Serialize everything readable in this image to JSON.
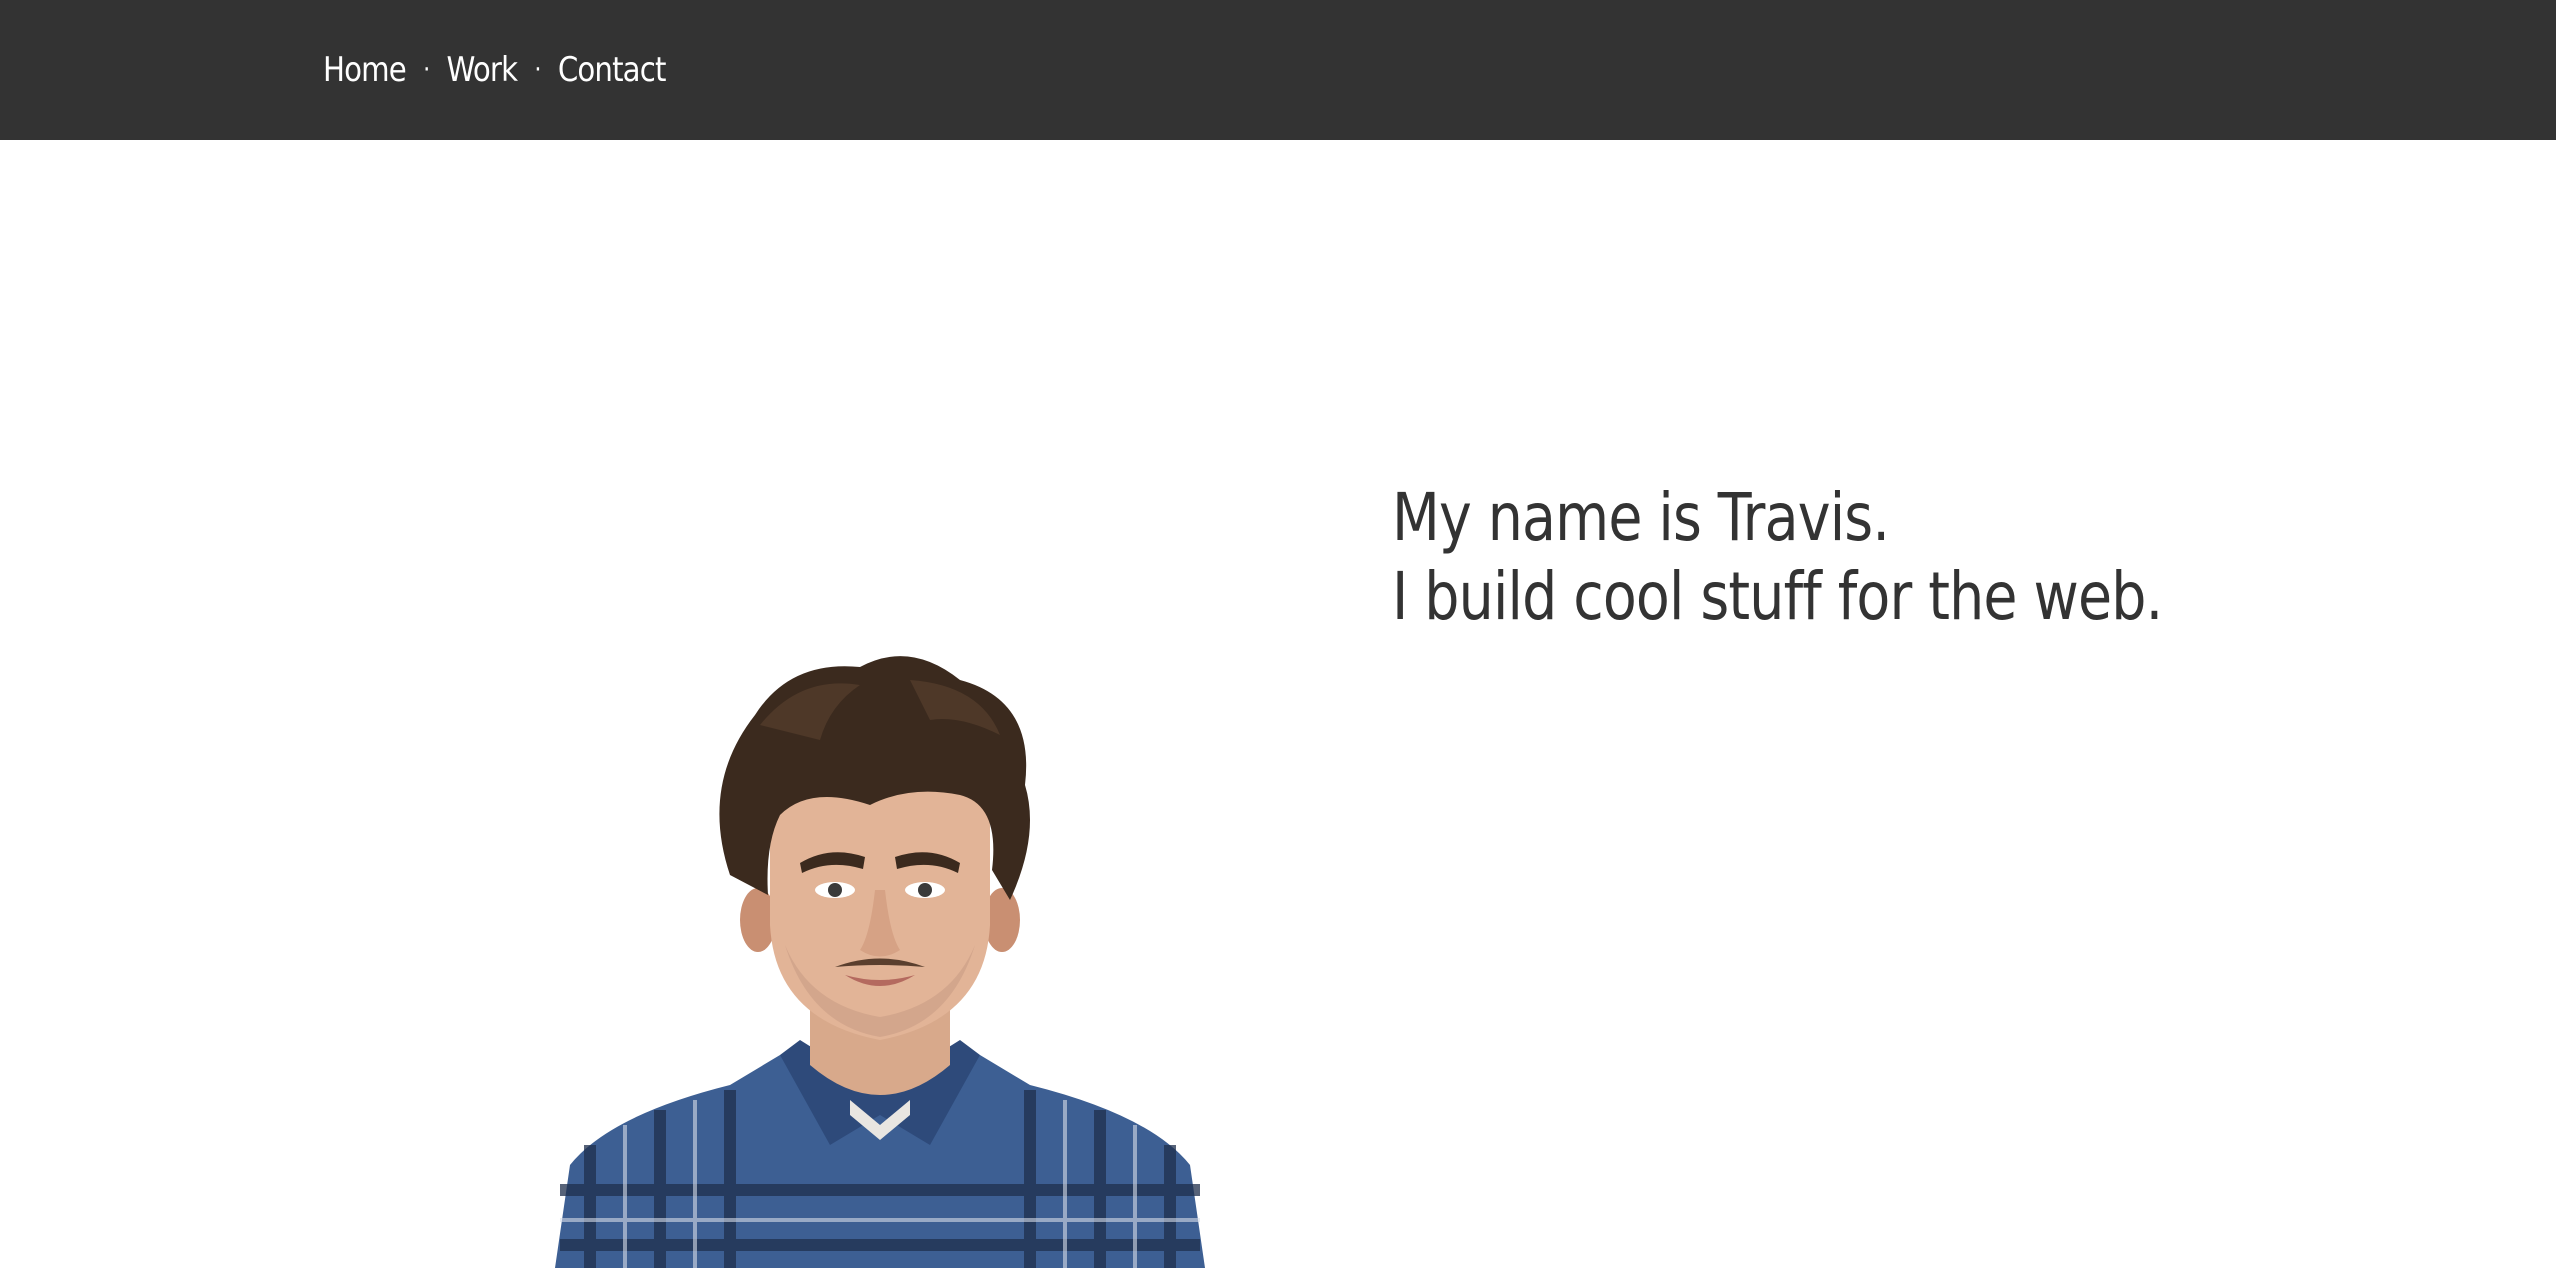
{
  "nav": {
    "items": [
      "Home",
      "Work",
      "Contact"
    ],
    "separator": "·"
  },
  "hero": {
    "line1": "My name is Travis.",
    "line2": "I build cool stuff for the web."
  },
  "colors": {
    "topbar": "#333333",
    "nav_text": "#ffffff",
    "hero_text": "#333333",
    "background": "#ffffff"
  }
}
